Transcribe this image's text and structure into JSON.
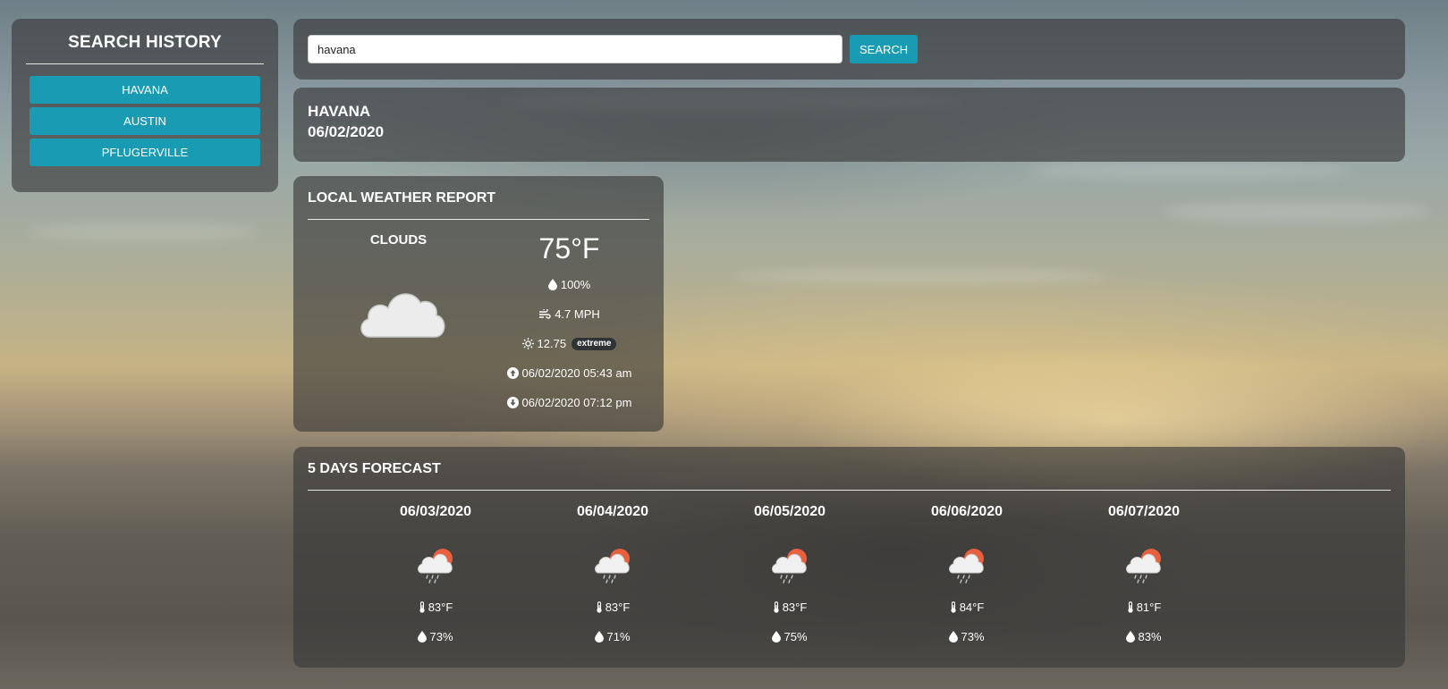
{
  "sidebar": {
    "title": "SEARCH HISTORY",
    "items": [
      {
        "label": "HAVANA"
      },
      {
        "label": "AUSTIN"
      },
      {
        "label": "PFLUGERVILLE"
      }
    ]
  },
  "search": {
    "value": "havana",
    "button_label": "SEARCH"
  },
  "current": {
    "city": "HAVANA",
    "date": "06/02/2020"
  },
  "local": {
    "title": "LOCAL WEATHER REPORT",
    "condition": "CLOUDS",
    "condition_icon": "cloud-icon",
    "temperature": "75°F",
    "humidity": "100%",
    "wind": "4.7 MPH",
    "uv_index": "12.75",
    "uv_badge": "extreme",
    "sunrise": "06/02/2020 05:43 am",
    "sunset": "06/02/2020 07:12 pm"
  },
  "forecast": {
    "title": "5 DAYS FORECAST",
    "days": [
      {
        "date": "06/03/2020",
        "temp": "83°F",
        "humidity": "73%",
        "icon": "sun-cloud-rain-icon"
      },
      {
        "date": "06/04/2020",
        "temp": "83°F",
        "humidity": "71%",
        "icon": "sun-cloud-rain-icon"
      },
      {
        "date": "06/05/2020",
        "temp": "83°F",
        "humidity": "75%",
        "icon": "sun-cloud-rain-icon"
      },
      {
        "date": "06/06/2020",
        "temp": "84°F",
        "humidity": "73%",
        "icon": "sun-cloud-rain-icon"
      },
      {
        "date": "06/07/2020",
        "temp": "81°F",
        "humidity": "83%",
        "icon": "sun-cloud-rain-icon"
      }
    ]
  },
  "colors": {
    "accent": "#1a9bb4",
    "panel": "rgba(55,55,55,0.62)",
    "sun": "#e8613f",
    "badge": "#2f3336"
  }
}
